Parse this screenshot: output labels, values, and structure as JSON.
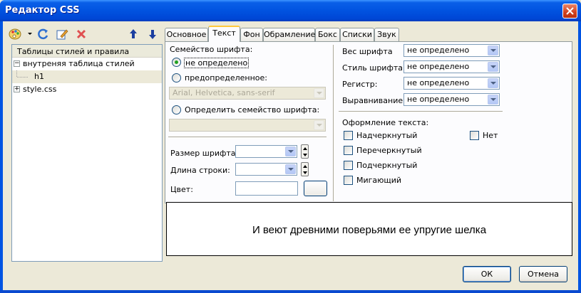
{
  "window": {
    "title": "Редактор CSS"
  },
  "tree": {
    "header": "Таблицы стилей и правила",
    "items": [
      {
        "label": "внутреняя таблица стилей",
        "expander": "−"
      },
      {
        "label": "h1"
      },
      {
        "label": "style.css",
        "expander": "+"
      }
    ]
  },
  "tabs": [
    "Основное",
    "Текст",
    "Фон",
    "Обрамление",
    "Бокс",
    "Списки",
    "Звук"
  ],
  "active_tab": "Текст",
  "font": {
    "family_label": "Семейство шрифта:",
    "opt_undefined": "не определено",
    "opt_predefined": "предопределенное:",
    "predefined_value": "Arial, Helvetica, sans-serif",
    "opt_custom": "Определить семейство шрифта:",
    "custom_value": "",
    "size_label": "Размер шрифта:",
    "line_label": "Длина строки:",
    "color_label": "Цвет:"
  },
  "props": [
    {
      "label": "Вес шрифта",
      "value": "не определено"
    },
    {
      "label": "Стиль шрифта:",
      "value": "не определено"
    },
    {
      "label": "Регистр:",
      "value": "не определено"
    },
    {
      "label": "Выравнивание:",
      "value": "не определено"
    }
  ],
  "decoration": {
    "label": "Оформление текста:",
    "options": [
      "Надчеркнутый",
      "Перечеркнутый",
      "Подчеркнутый",
      "Мигающий"
    ],
    "none": "Нет"
  },
  "preview_text": "И веют древними поверьями ее упругие шелка",
  "buttons": {
    "ok": "ОК",
    "cancel": "Отмена"
  },
  "icons": [
    "palette-icon",
    "refresh-icon",
    "edit-icon",
    "delete-icon",
    "arrow-up-icon",
    "arrow-down-icon"
  ]
}
